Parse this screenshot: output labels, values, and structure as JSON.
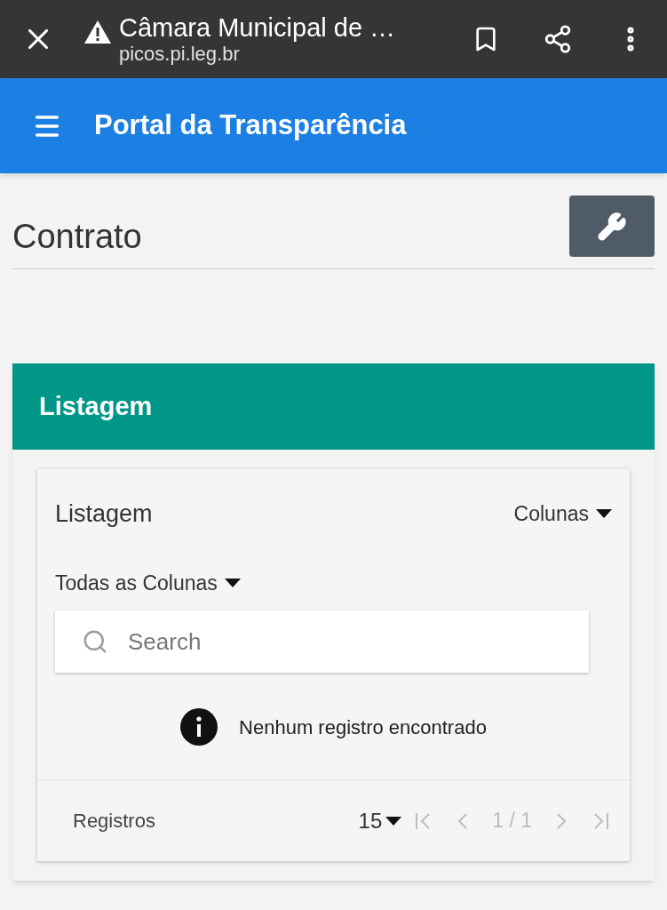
{
  "browser": {
    "title": "Câmara Municipal de …",
    "url": "picos.pi.leg.br"
  },
  "app_bar": {
    "title": "Portal da Transparência"
  },
  "page": {
    "title": "Contrato"
  },
  "panel": {
    "title": "Listagem",
    "inner_title": "Listagem",
    "columns_menu": "Colunas",
    "filter_menu": "Todas as Colunas",
    "search": {
      "placeholder": "Search"
    },
    "empty_message": "Nenhum registro encontrado",
    "footer": {
      "label": "Registros",
      "page_size": "15",
      "page_info": "1 / 1",
      "nav": [
        {
          "kind": "first",
          "disabled": true
        },
        {
          "kind": "prev",
          "disabled": true
        },
        {
          "kind": "next",
          "disabled": true
        },
        {
          "kind": "last",
          "disabled": true
        }
      ]
    }
  }
}
